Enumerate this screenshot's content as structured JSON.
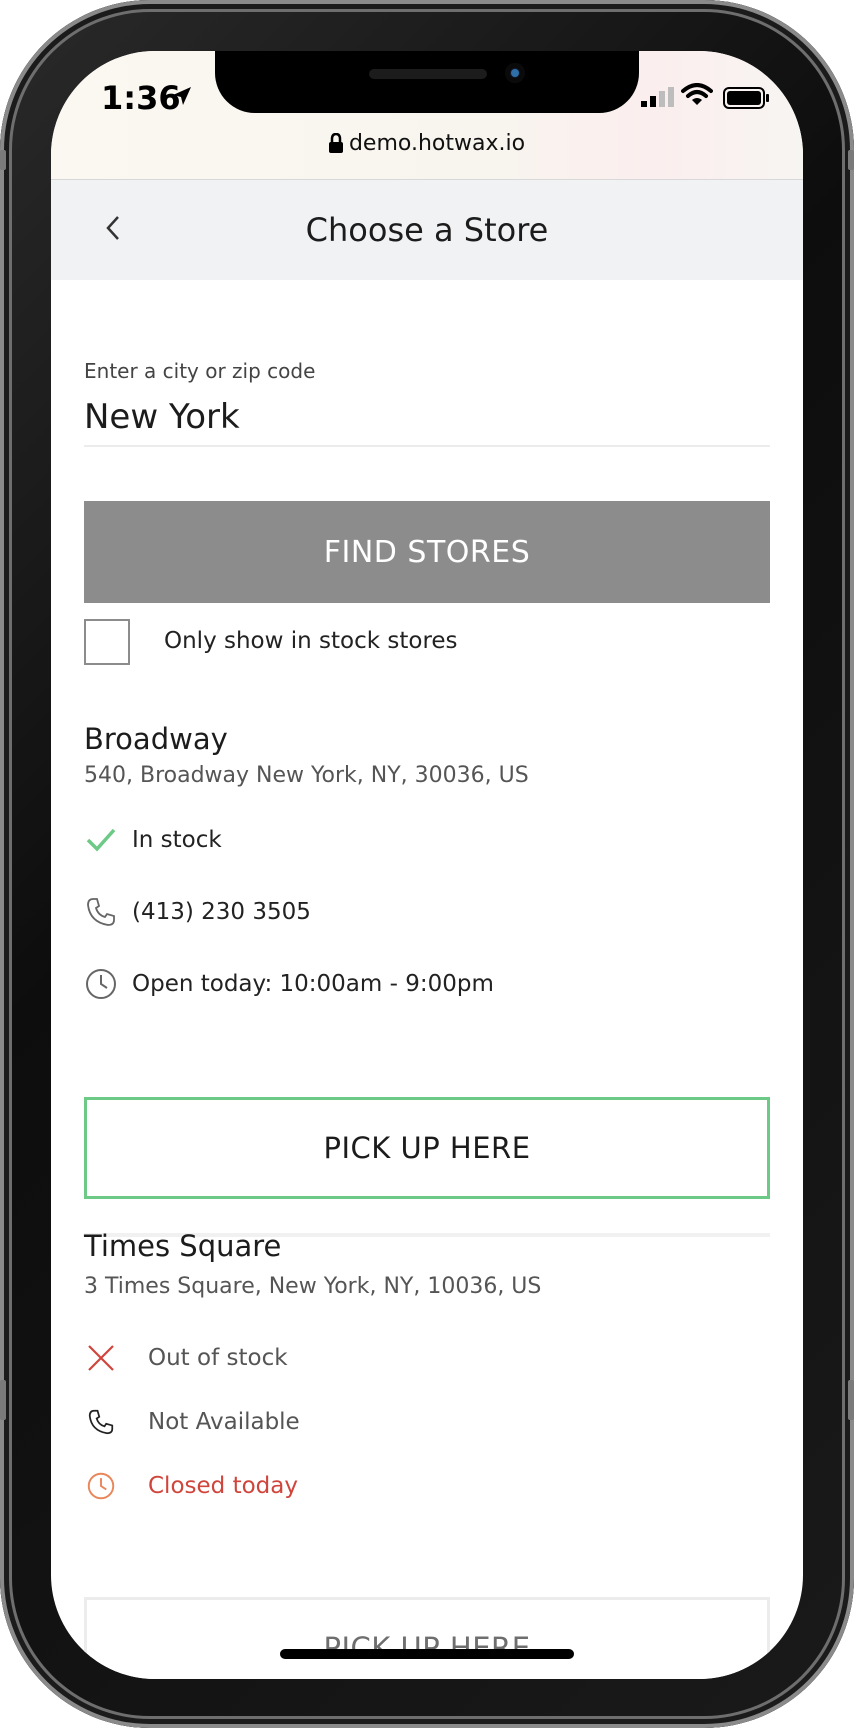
{
  "status_bar": {
    "time": "1:36",
    "url": "demo.hotwax.io",
    "icons": [
      "location-arrow-icon",
      "cellular-signal-icon",
      "wifi-icon",
      "battery-icon",
      "lock-icon"
    ]
  },
  "nav": {
    "title": "Choose a Store",
    "back_icon": "chevron-left-icon"
  },
  "search": {
    "label": "Enter a city or zip code",
    "value": "New York",
    "placeholder": "",
    "button_label": "FIND STORES"
  },
  "filter": {
    "checkbox_label": "Only show in stock stores",
    "checked": false
  },
  "stores": [
    {
      "name": "Broadway",
      "address": "540, Broadway New York, NY, 30036, US",
      "stock": "In stock",
      "phone": "(413) 230 3505",
      "hours": "Open today: 10:00am - 9:00pm",
      "button_label": "PICK UP HERE",
      "icons": [
        "checkmark-icon",
        "phone-icon",
        "clock-icon"
      ]
    },
    {
      "name": "Times Square",
      "address": "3 Times Square, New York, NY, 10036, US",
      "stock": "Out of stock",
      "phone": "Not Available",
      "hours": "Closed today",
      "button_label": "PICK UP HERE",
      "icons": [
        "x-mark-icon",
        "phone-icon",
        "clock-icon"
      ]
    }
  ],
  "colors": {
    "accent_green": "#6cc986",
    "error_red": "#d0453b",
    "clock_orange": "#e9865a",
    "button_gray": "#8c8c8c",
    "nav_background": "#f1f2f4"
  }
}
